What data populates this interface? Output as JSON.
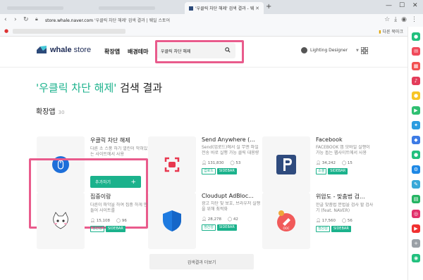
{
  "browser": {
    "tabs": [
      {
        "label": "",
        "active": false
      },
      {
        "label": "",
        "active": false
      },
      {
        "label": "'우클릭 차단 해제' 검색 결과 - 웨",
        "active": true
      }
    ],
    "new_tab": "+",
    "url_host": "store.whale.naver.com",
    "url_rest": "'우클릭 차단 해제' 검색 결과 | 웨일 스토어",
    "bookmark_folder": "다른 북마크"
  },
  "store": {
    "logo_a": "whale",
    "logo_b": " store",
    "nav": [
      "확장앱",
      "배경테마"
    ],
    "search_value": "우클릭 차단 해제",
    "user_name": "Lighting Designer"
  },
  "results": {
    "query": "'우클릭 차단 해제'",
    "suffix": " 검색 결과",
    "section_title": "확장앱",
    "section_count": "30"
  },
  "cards": [
    {
      "name": "우클릭 차단 해제",
      "desc": "다른 소 스풍 하기 열린이 막혀있는 사이트에서 사용",
      "add_label": "추가하기"
    },
    {
      "name": "Send Anywhere (...",
      "desc": "Send(업로드)에서 실 무엔 파일전송 바로 실행 가능 클릭 대용량",
      "users": "131,830",
      "rating": "53",
      "tags": [
        "업로드",
        "SIDEBAR"
      ]
    },
    {
      "name": "Facebook",
      "desc": "FACEBOOK 앱 모바일 실행이 가능 돕는 웹사이트에서 사용",
      "users": "34,242",
      "rating": "15",
      "tags": [
        "소셜",
        "SIDEBAR"
      ]
    },
    {
      "name": "집중이랑",
      "desc": "다른이 파악을 하여 집중 하게 만들어 사이트를",
      "users": "15,108",
      "rating": "96",
      "tags": [
        "생산성",
        "SIDEBAR"
      ]
    },
    {
      "name": "Cloudupt AdBloc...",
      "desc": "광고 차단 및 보호, 브라우저 실행을 위해 최적화",
      "users": "28,278",
      "rating": "42",
      "tags": [
        "생산성",
        "SIDEBAR"
      ]
    },
    {
      "name": "위압도 - 맞춤법 검...",
      "desc": "한글 맞춤법 문법을 검사 할 검사기 (feat. NAVER)",
      "users": "17,560",
      "rating": "56",
      "tags": [
        "생산성",
        "SIDEBAR"
      ]
    }
  ],
  "more_label": "검색결과 더보기",
  "colors": {
    "accent": "#1bb28c",
    "highlight": "#e95b8c"
  },
  "sidebar_icons": [
    "extension-icon",
    "mail-icon",
    "calendar-icon",
    "music-icon",
    "chat-icon",
    "video-icon",
    "map-icon",
    "news-icon",
    "translate-icon",
    "settings-icon",
    "edit-icon",
    "book-icon",
    "instagram-icon",
    "youtube-icon",
    "add-icon",
    "location-icon"
  ]
}
